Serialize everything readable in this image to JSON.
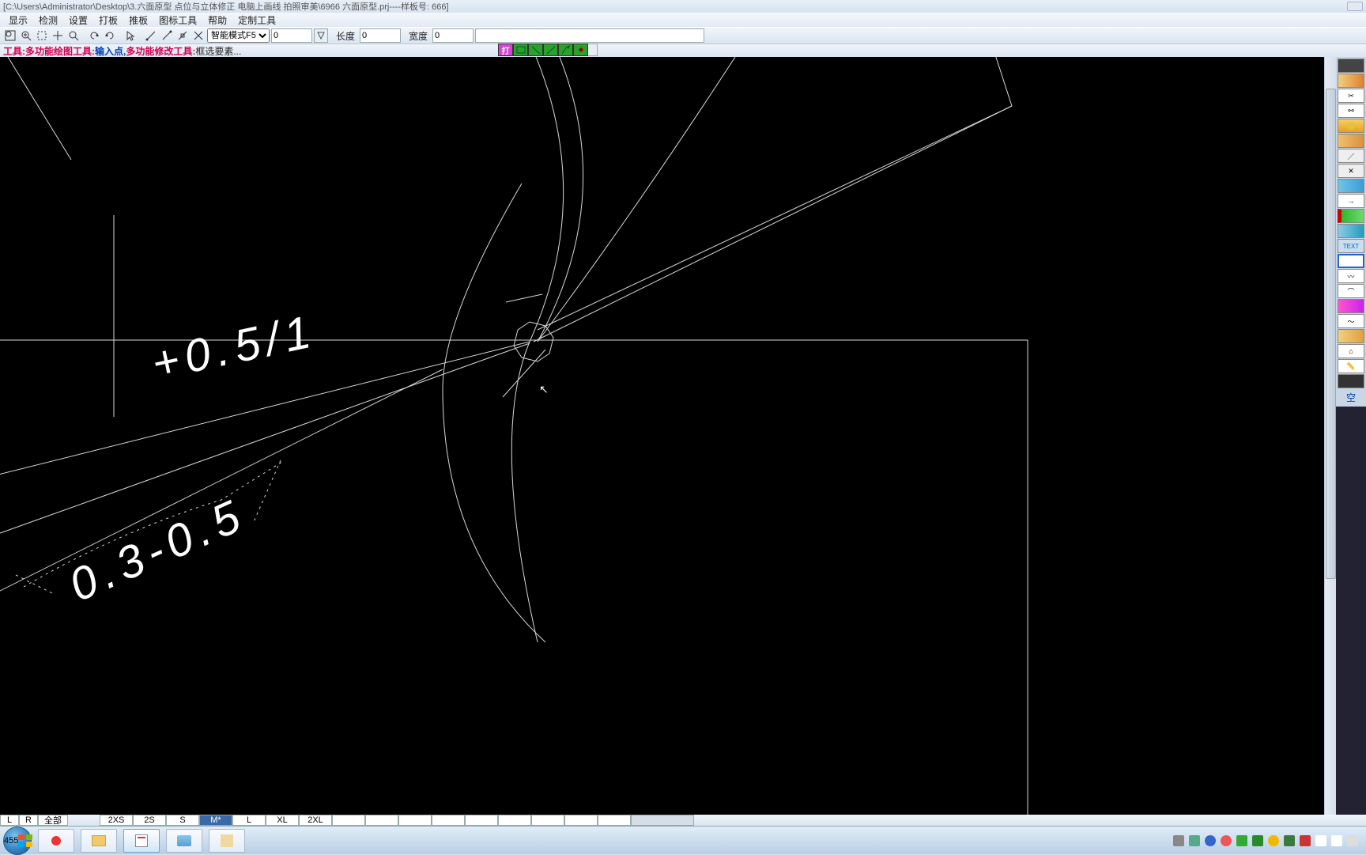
{
  "title": "[C:\\Users\\Administrator\\Desktop\\3.六面原型  点位与立体修正  电脑上画线 拍照审美\\6966 六面原型.prj----样板号: 666]",
  "menu": {
    "items": [
      "显示",
      "检测",
      "设置",
      "打板",
      "推板",
      "图标工具",
      "帮助",
      "定制工具"
    ]
  },
  "toolbar": {
    "mode_select": "智能模式F5",
    "num1": "0",
    "len_label": "长度",
    "len_val": "0",
    "wid_label": "宽度",
    "wid_val": "0"
  },
  "hint": {
    "pre": "工具:",
    "t1": "多功能绘图工具:",
    "mid": "输入点,",
    "t2": "多功能修改工具:",
    "end": "框选要素...",
    "center_label": "打"
  },
  "canvas": {
    "text_top": "+0.5/1",
    "text_bot": "0.3-0.5"
  },
  "rtool_last": "空",
  "sizes": {
    "lrp": [
      "L",
      "R",
      "全部"
    ],
    "list": [
      "2XS",
      "2S",
      "S",
      "M*",
      "L",
      "XL",
      "2XL"
    ],
    "selected": "M*"
  },
  "tray_icons": [
    "speaker",
    "net",
    "ime",
    "green",
    "shield",
    "blue",
    "orange",
    "flag",
    "dot"
  ]
}
